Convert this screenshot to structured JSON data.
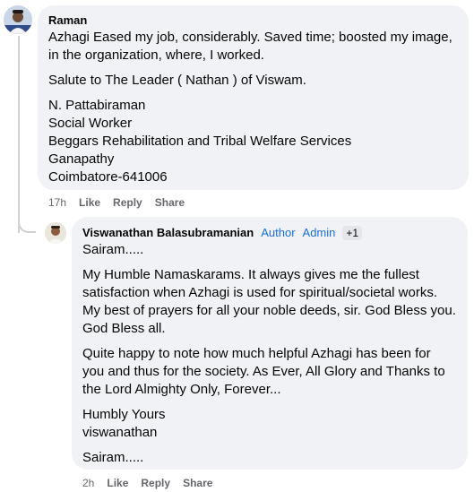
{
  "comment": {
    "author": "Raman",
    "paragraphs": [
      [
        "Azhagi Eased my job, considerably. Saved time; boosted my image,",
        "in the organization, where, I worked."
      ],
      [
        "Salute to The Leader ( Nathan ) of Viswam."
      ],
      [
        "N. Pattabiraman",
        "Social Worker",
        "Beggars Rehabilitation and Tribal Welfare Services",
        "Ganapathy",
        "Coimbatore-641006"
      ]
    ],
    "time": "17h",
    "like_label": "Like",
    "reply_label": "Reply",
    "share_label": "Share"
  },
  "reply": {
    "author": "Viswanathan Balasubramanian",
    "badge_author": "Author",
    "badge_admin": "Admin",
    "badge_more": "+1",
    "paragraphs": [
      [
        "Sairam....."
      ],
      [
        "My Humble Namaskarams. It always gives me the fullest",
        "satisfaction when Azhagi is used for spiritual/societal works.",
        "My best of prayers for all your noble deeds, sir. God Bless you.",
        "God Bless all."
      ],
      [
        "Quite happy to note how much helpful Azhagi has been for",
        "you and thus for the society. As Ever, All Glory and Thanks to",
        "the Lord Almighty Only, Forever..."
      ],
      [
        "Humbly Yours",
        "viswanathan"
      ],
      [
        "Sairam....."
      ]
    ],
    "time": "2h",
    "like_label": "Like",
    "reply_label": "Reply",
    "share_label": "Share"
  },
  "colors": {
    "bubble": "#f0f2f5",
    "badge_blue": "#1b6fd8",
    "meta_gray": "#65676b"
  }
}
